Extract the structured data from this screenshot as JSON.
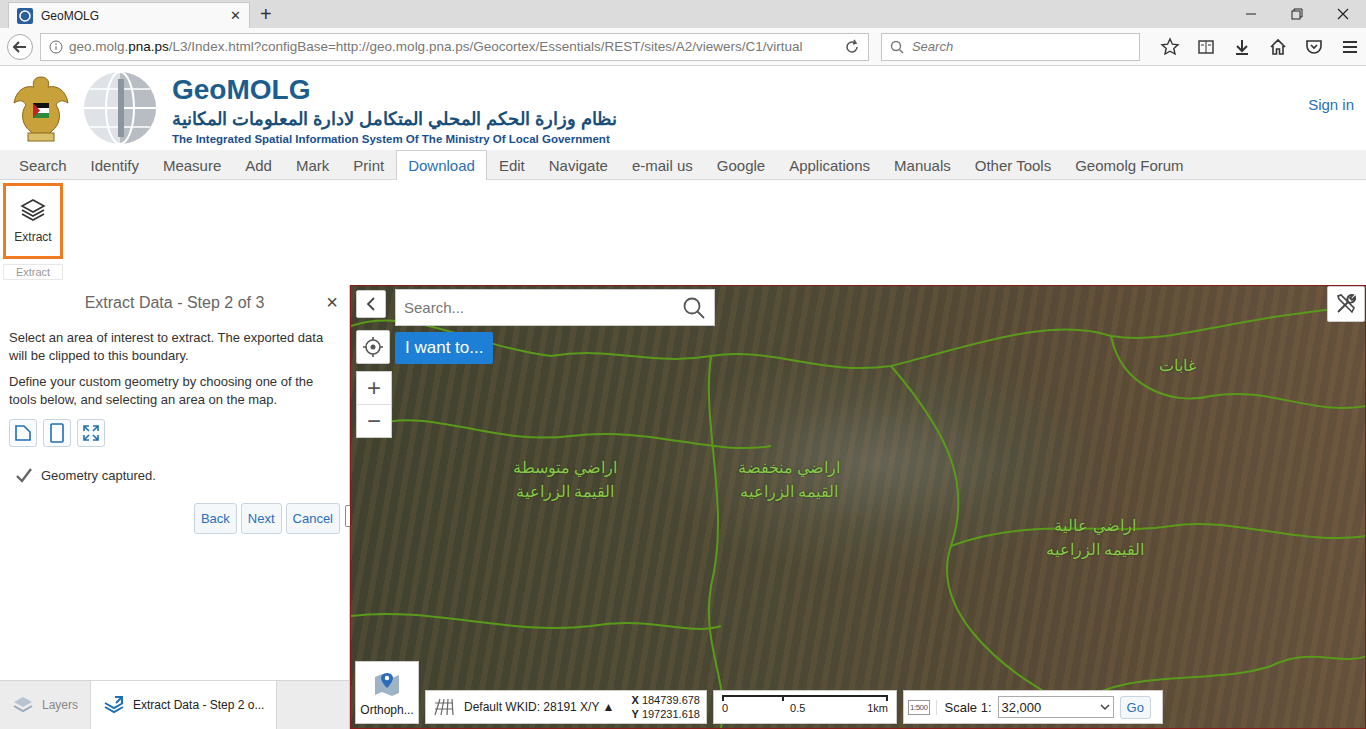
{
  "browser": {
    "tab_title": "GeoMOLG",
    "tab_close": "✕",
    "new_tab": "+",
    "url_prefix": "geo.molg.",
    "url_domain": "pna.ps",
    "url_rest": "/L3/Index.html?configBase=http://geo.molg.pna.ps/Geocortex/Essentials/REST/sites/A2/viewers/C1/virtual",
    "search_placeholder": "Search"
  },
  "header": {
    "title": "GeoMOLG",
    "arabic": "نظام وزارة الحكم المحلي المتكامل لادارة المعلومات المكانية",
    "subtitle": "The Integrated Spatial Information System Of The Ministry Of Local Government",
    "sign_in": "Sign in"
  },
  "menu": [
    {
      "label": "Search",
      "selected": false
    },
    {
      "label": "Identify",
      "selected": false
    },
    {
      "label": "Measure",
      "selected": false
    },
    {
      "label": "Add",
      "selected": false
    },
    {
      "label": "Mark",
      "selected": false
    },
    {
      "label": "Print",
      "selected": false
    },
    {
      "label": "Download",
      "selected": true
    },
    {
      "label": "Edit",
      "selected": false
    },
    {
      "label": "Navigate",
      "selected": false
    },
    {
      "label": "e-mail us",
      "selected": false
    },
    {
      "label": "Google",
      "selected": false
    },
    {
      "label": "Applications",
      "selected": false
    },
    {
      "label": "Manuals",
      "selected": false
    },
    {
      "label": "Other Tools",
      "selected": false
    },
    {
      "label": "Geomolg Forum",
      "selected": false
    }
  ],
  "toolbar": {
    "buttons": [
      {
        "label": "Extract",
        "selected": true
      }
    ],
    "group_label": "Extract"
  },
  "panel": {
    "title": "Extract Data - Step 2 of 3",
    "close": "×",
    "paragraphs": [
      "Select an area of interest to extract. The exported data will be clipped to this boundary.",
      "Define your custom geometry by choosing one of the tools below, and selecting an area on the map."
    ],
    "status": "Geometry captured.",
    "buttons": [
      "Back",
      "Next",
      "Cancel"
    ]
  },
  "bottom_tabs": [
    {
      "label": "Layers",
      "selected": false
    },
    {
      "label": "Extract Data - Step 2 o...",
      "selected": true
    }
  ],
  "map": {
    "search_placeholder": "Search...",
    "i_want_to": "I want to...",
    "zoom_in": "+",
    "zoom_out": "−",
    "labels": [
      "غابات",
      "اراضي متوسطة القيمة الزراعية",
      "اراضي منخفضة القيمه الزراعيه",
      "اراضي عالية القيمه الزراعيه"
    ],
    "basemap": "Orthoph...",
    "wkid": "Default WKID: 28191 X/Y ▲",
    "x_label": "X",
    "x": "184739.678",
    "y_label": "Y",
    "y": "197231.618",
    "scale_bar": [
      "0",
      "0.5",
      "1km"
    ],
    "scale_icon": "1:500",
    "scale_label": "Scale 1:",
    "scale_value": "32,000",
    "go": "Go"
  }
}
